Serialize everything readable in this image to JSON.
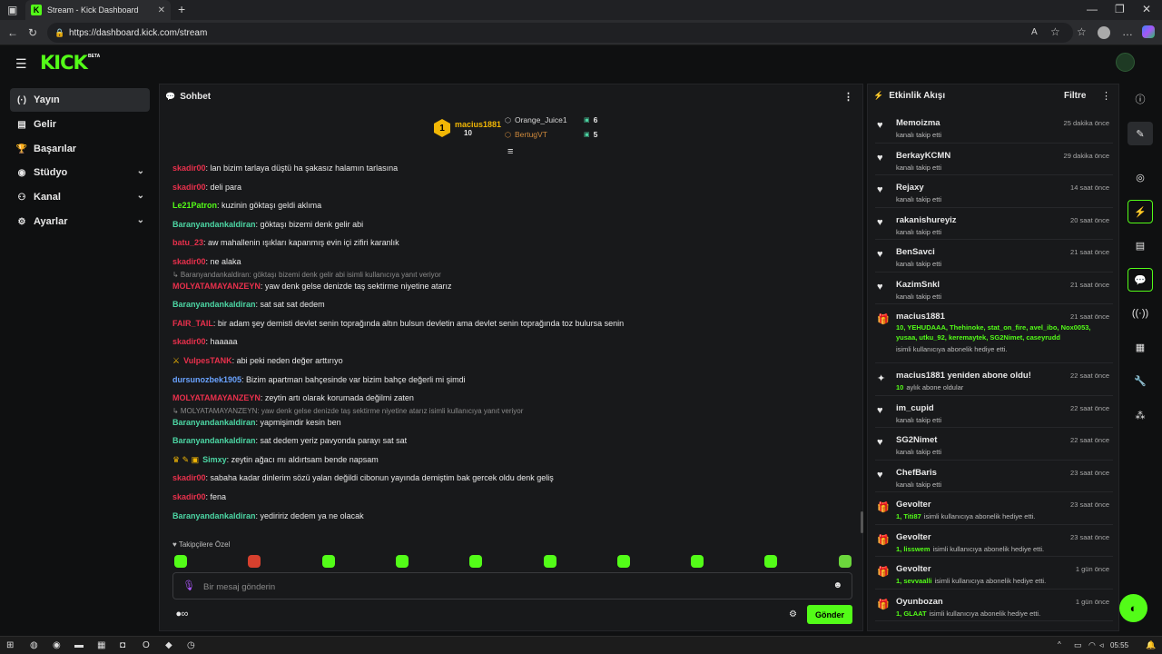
{
  "browser": {
    "tab_title": "Stream - Kick Dashboard",
    "url": "https://dashboard.kick.com/stream",
    "new_tab": "+"
  },
  "header": {
    "logo": "KICK",
    "badge": "BETA"
  },
  "sidebar": {
    "items": [
      {
        "label": "Yayın",
        "icon": "broadcast-icon",
        "glyph": "(·)",
        "active": true
      },
      {
        "label": "Gelir",
        "icon": "revenue-icon",
        "glyph": "▤"
      },
      {
        "label": "Başarılar",
        "icon": "trophy-icon",
        "glyph": "🏆"
      },
      {
        "label": "Stüdyo",
        "icon": "studio-icon",
        "glyph": "◉",
        "expandable": true
      },
      {
        "label": "Kanal",
        "icon": "channel-icon",
        "glyph": "⚇",
        "expandable": true
      },
      {
        "label": "Ayarlar",
        "icon": "settings-icon",
        "glyph": "⚙",
        "expandable": true
      }
    ]
  },
  "chat": {
    "title": "Sohbet",
    "leaders": [
      {
        "rank": "1",
        "name": "macius1881",
        "count": "10"
      },
      {
        "name": "Orange_Juice1",
        "count": "6"
      },
      {
        "name": "BertugVT",
        "count": "5"
      }
    ],
    "messages": [
      {
        "user": "skadir00",
        "color": "#e8304c",
        "text": ": lan bizim tarlaya düştü ha şakasız halamın tarlasına"
      },
      {
        "user": "skadir00",
        "color": "#e8304c",
        "text": ": deli para"
      },
      {
        "user": "Le21Patron",
        "color": "#53fc18",
        "text": ": kuzinin göktaşı geldi aklıma"
      },
      {
        "user": "Baranyandankaldiran",
        "color": "#4cd6a4",
        "text": ": göktaşı bizemi denk gelir abi"
      },
      {
        "user": "batu_23",
        "color": "#e8304c",
        "text": ": aw mahallenin ışıkları kapanmış evin içi zifiri karanlık"
      },
      {
        "user": "skadir00",
        "color": "#e8304c",
        "text": ": ne alaka"
      },
      {
        "reply": "↳ Baranyandankaldiran: göktaşı bizemi denk gelir abi isimli kullanıcıya yanıt veriyor",
        "user": "MOLYATAMAYANZEYN",
        "color": "#e8304c",
        "text": ": yaw denk gelse denizde taş sektirme niyetine atarız"
      },
      {
        "user": "Baranyandankaldiran",
        "color": "#4cd6a4",
        "text": ": sat sat sat dedem"
      },
      {
        "user": "FAIR_TAIL",
        "color": "#e8304c",
        "text": ": bir adam şey demisti devlet senin toprağında altın bulsun devletin ama devlet senin toprağında toz bulursa senin"
      },
      {
        "user": "skadir00",
        "color": "#e8304c",
        "text": ": haaaaa"
      },
      {
        "badge": "⚔",
        "user": "VulpesTANK",
        "color": "#e8304c",
        "text": ": abi peki neden değer arttırıyo"
      },
      {
        "user": "dursunozbek1905",
        "color": "#6aa3ff",
        "text": ": Bizim apartman bahçesinde var bizim bahçe değerli mi şimdi"
      },
      {
        "user": "MOLYATAMAYANZEYN",
        "color": "#e8304c",
        "text": ": zeytin artı olarak korumada değilmi zaten"
      },
      {
        "reply": "↳ MOLYATAMAYANZEYN: yaw denk gelse denizde taş sektirme niyetine atarız isimli kullanıcıya yanıt veriyor",
        "user": "Baranyandankaldiran",
        "color": "#4cd6a4",
        "text": ": yapmişimdir kesin ben"
      },
      {
        "user": "Baranyandankaldiran",
        "color": "#4cd6a4",
        "text": ": sat dedem yeriz pavyonda parayı sat sat"
      },
      {
        "badge": "♛ ✎ ▣",
        "user": "Simxy",
        "color": "#4cd6a4",
        "text": ": zeytin ağacı mı aldırtsam bende napsam"
      },
      {
        "user": "skadir00",
        "color": "#e8304c",
        "text": ": sabaha kadar dinlerim sözü yalan değildi cibonun yayında demiştim bak gercek oldu denk geliş"
      },
      {
        "user": "skadir00",
        "color": "#e8304c",
        "text": ": fena"
      },
      {
        "user": "Baranyandankaldiran",
        "color": "#4cd6a4",
        "text": ": yediririz dedem ya ne olacak"
      }
    ],
    "emote_label": "Takipçilere Özel",
    "input_placeholder": "Bir mesaj gönderin",
    "send_label": "Gönder"
  },
  "activity": {
    "title": "Etkinlik Akışı",
    "filter_label": "Filtre",
    "events": [
      {
        "icon": "heart-icon",
        "glyph": "♥",
        "name": "Memoizma",
        "sub": "kanalı takip etti",
        "time": "25 dakika önce"
      },
      {
        "icon": "heart-icon",
        "glyph": "♥",
        "name": "BerkayKCMN",
        "sub": "kanalı takip etti",
        "time": "29 dakika önce"
      },
      {
        "icon": "heart-icon",
        "glyph": "♥",
        "name": "Rejaxy",
        "sub": "kanalı takip etti",
        "time": "14 saat önce"
      },
      {
        "icon": "heart-icon",
        "glyph": "♥",
        "name": "rakanishureyiz",
        "sub": "kanalı takip etti",
        "time": "20 saat önce"
      },
      {
        "icon": "heart-icon",
        "glyph": "♥",
        "name": "BenSavci",
        "sub": "kanalı takip etti",
        "time": "21 saat önce"
      },
      {
        "icon": "heart-icon",
        "glyph": "♥",
        "name": "KazimSnkl",
        "sub": "kanalı takip etti",
        "time": "21 saat önce"
      },
      {
        "icon": "gift-icon",
        "glyph": "🎁",
        "name": "macius1881",
        "green": "10, YEHUDAAA, Thehinoke, stat_on_fire, avel_ibo, Nox0053, yusaa, utku_92, keremaytek, SG2Nimet, caseyrudd",
        "sub": "isimli kullanıcıya abonelik hediye etti.",
        "time": "21 saat önce"
      },
      {
        "icon": "sparkle-icon",
        "glyph": "✦",
        "name": "macius1881 yeniden abone oldu!",
        "green": "10",
        "sub": "aylık abone oldular",
        "time": "22 saat önce"
      },
      {
        "icon": "heart-icon",
        "glyph": "♥",
        "name": "im_cupid",
        "sub": "kanalı takip etti",
        "time": "22 saat önce"
      },
      {
        "icon": "heart-icon",
        "glyph": "♥",
        "name": "SG2Nimet",
        "sub": "kanalı takip etti",
        "time": "22 saat önce"
      },
      {
        "icon": "heart-icon",
        "glyph": "♥",
        "name": "ChefBaris",
        "sub": "kanalı takip etti",
        "time": "23 saat önce"
      },
      {
        "icon": "gift-icon",
        "glyph": "🎁",
        "name": "Gevolter",
        "green": "1, Titi87",
        "sub": "isimli kullanıcıya abonelik hediye etti.",
        "time": "23 saat önce"
      },
      {
        "icon": "gift-icon",
        "glyph": "🎁",
        "name": "Gevolter",
        "green": "1, lisswem",
        "sub": "isimli kullanıcıya abonelik hediye etti.",
        "time": "23 saat önce"
      },
      {
        "icon": "gift-icon",
        "glyph": "🎁",
        "name": "Gevolter",
        "green": "1, sevvaalli",
        "sub": "isimli kullanıcıya abonelik hediye etti.",
        "time": "1 gün önce"
      },
      {
        "icon": "gift-icon",
        "glyph": "🎁",
        "name": "Oyunbozan",
        "green": "1, GLAAT",
        "sub": "isimli kullanıcıya abonelik hediye etti.",
        "time": "1 gün önce"
      }
    ]
  },
  "taskbar": {
    "time": "05:55"
  }
}
